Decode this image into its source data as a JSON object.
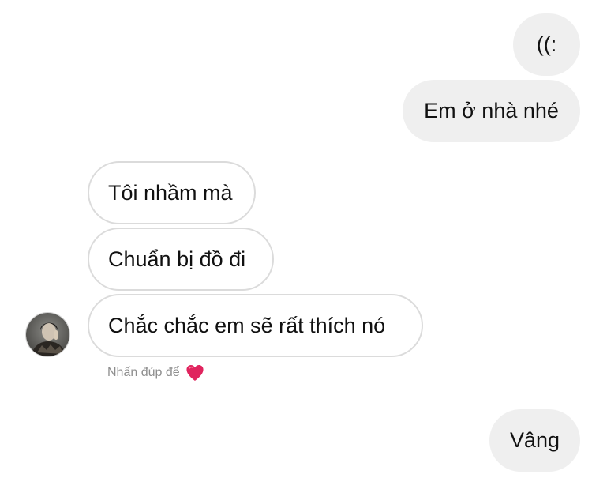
{
  "conversation": {
    "messages": [
      {
        "direction": "outgoing",
        "text": "((:"
      },
      {
        "direction": "outgoing",
        "text": "Em ở nhà nhé"
      },
      {
        "direction": "incoming",
        "text": "Tôi nhầm mà"
      },
      {
        "direction": "incoming",
        "text": "Chuẩn bị đồ đi"
      },
      {
        "direction": "incoming",
        "text": "Chắc chắc em sẽ rất thích nó"
      },
      {
        "direction": "outgoing",
        "text": "Vâng"
      }
    ],
    "hint": {
      "text": "Nhấn đúp để",
      "icon": "heart-icon"
    },
    "avatar": {
      "icon": "contact-avatar"
    }
  },
  "colors": {
    "outgoing_bubble": "#efefef",
    "incoming_border": "#dbdbdb",
    "hint_text": "#8e8e8e",
    "heart": "#e0245e"
  }
}
